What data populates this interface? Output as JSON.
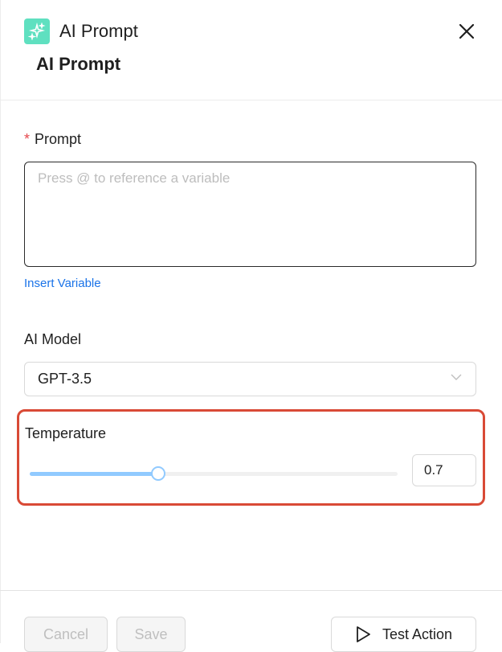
{
  "header": {
    "app_title": "AI Prompt",
    "step_title": "AI Prompt",
    "icon": "sparkles-icon",
    "close_icon": "close-icon",
    "accent": "#5fe0c0"
  },
  "form": {
    "prompt": {
      "label": "Prompt",
      "required_mark": "*",
      "value": "",
      "placeholder": "Press @ to reference a variable",
      "insert_variable": "Insert Variable"
    },
    "model": {
      "label": "AI Model",
      "selected": "GPT-3.5",
      "icon": "chevron-down-icon"
    },
    "temperature": {
      "label": "Temperature",
      "value": "0.7",
      "slider_fraction": 0.35,
      "highlight_color": "#d94a36"
    }
  },
  "footer": {
    "cancel": "Cancel",
    "save": "Save",
    "test": "Test Action",
    "test_icon": "play-icon"
  }
}
